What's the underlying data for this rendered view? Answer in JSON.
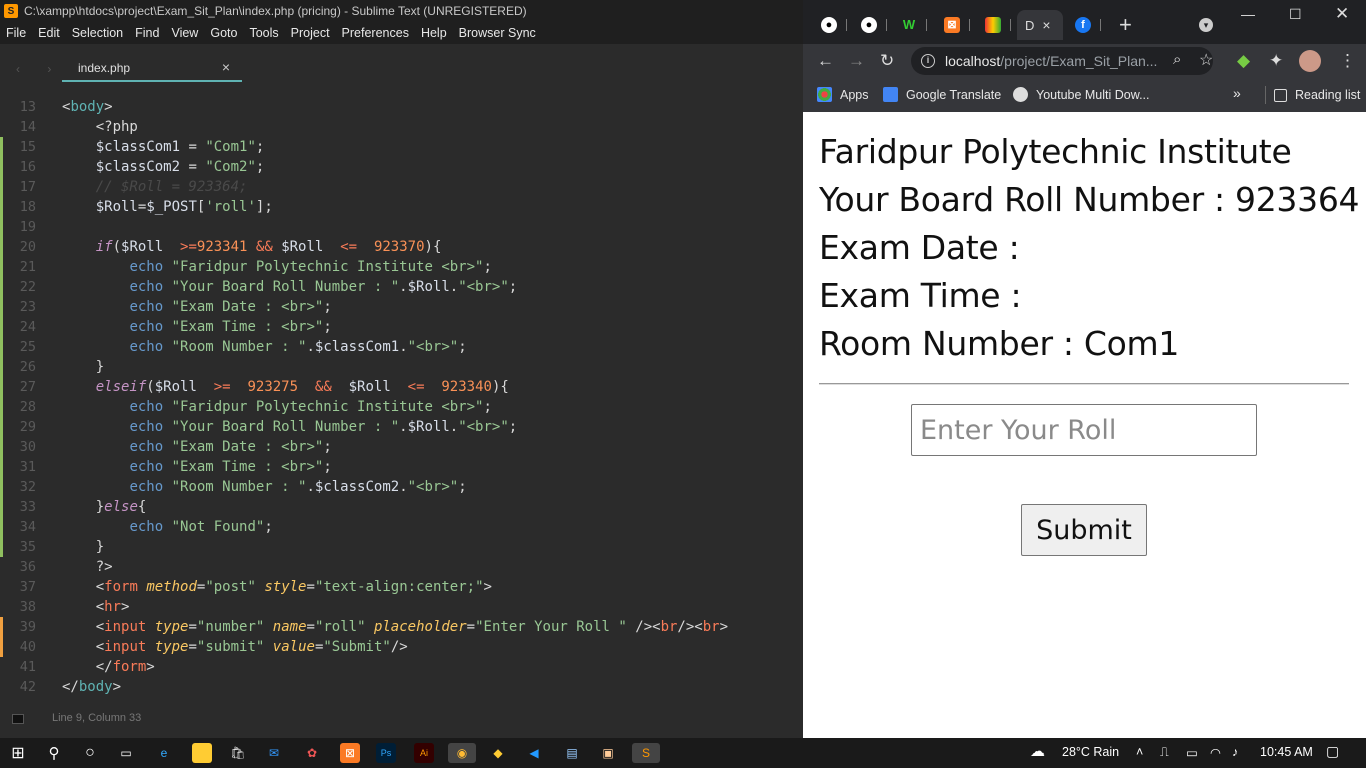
{
  "sublime": {
    "title": "C:\\xampp\\htdocs\\project\\Exam_Sit_Plan\\index.php (pricing) - Sublime Text (UNREGISTERED)",
    "menu": [
      "File",
      "Edit",
      "Selection",
      "Find",
      "View",
      "Goto",
      "Tools",
      "Project",
      "Preferences",
      "Help",
      "Browser Sync"
    ],
    "tab_label": "index.php",
    "status": "Line 9, Column 33",
    "lines": [
      {
        "n": "13",
        "mod": "",
        "html": "<span class=\"punc\">&lt;</span><span class=\"t\">body</span><span class=\"punc\">&gt;</span>"
      },
      {
        "n": "14",
        "mod": "",
        "html": "    <span class=\"punc\">&lt;?php</span>"
      },
      {
        "n": "15",
        "mod": "g",
        "html": "    <span class=\"var\">$classCom1</span> = <span class=\"str\">\"Com1\"</span>;"
      },
      {
        "n": "16",
        "mod": "g",
        "html": "    <span class=\"var\">$classCom2</span> = <span class=\"str\">\"Com2\"</span>;"
      },
      {
        "n": "17",
        "mod": "g",
        "html": "    <span class=\"cmt\">// $Roll = 923364;</span>"
      },
      {
        "n": "18",
        "mod": "g",
        "html": "    <span class=\"var\">$Roll</span>=<span class=\"var\">$_POST</span>[<span class=\"str\">'roll'</span>];"
      },
      {
        "n": "19",
        "mod": "g",
        "html": ""
      },
      {
        "n": "20",
        "mod": "g",
        "html": "    <span class=\"kw\">if</span>(<span class=\"var\">$Roll</span>  <span class=\"op\">&gt;=</span><span class=\"num\">923341</span> <span class=\"op\">&amp;&amp;</span> <span class=\"var\">$Roll</span>  <span class=\"op\">&lt;=</span>  <span class=\"num\">923370</span>){"
      },
      {
        "n": "21",
        "mod": "g",
        "html": "        <span class=\"fn\">echo</span> <span class=\"str\">\"Faridpur Polytechnic Institute &lt;br&gt;\"</span>;"
      },
      {
        "n": "22",
        "mod": "g",
        "html": "        <span class=\"fn\">echo</span> <span class=\"str\">\"Your Board Roll Number : \"</span>.<span class=\"var\">$Roll</span>.<span class=\"str\">\"&lt;br&gt;\"</span>;"
      },
      {
        "n": "23",
        "mod": "g",
        "html": "        <span class=\"fn\">echo</span> <span class=\"str\">\"Exam Date : &lt;br&gt;\"</span>;"
      },
      {
        "n": "24",
        "mod": "g",
        "html": "        <span class=\"fn\">echo</span> <span class=\"str\">\"Exam Time : &lt;br&gt;\"</span>;"
      },
      {
        "n": "25",
        "mod": "g",
        "html": "        <span class=\"fn\">echo</span> <span class=\"str\">\"Room Number : \"</span>.<span class=\"var\">$classCom1</span>.<span class=\"str\">\"&lt;br&gt;\"</span>;"
      },
      {
        "n": "26",
        "mod": "g",
        "html": "    }"
      },
      {
        "n": "27",
        "mod": "g",
        "html": "    <span class=\"kw\">elseif</span>(<span class=\"var\">$Roll</span>  <span class=\"op\">&gt;=</span>  <span class=\"num\">923275</span>  <span class=\"op\">&amp;&amp;</span>  <span class=\"var\">$Roll</span>  <span class=\"op\">&lt;=</span>  <span class=\"num\">923340</span>){"
      },
      {
        "n": "28",
        "mod": "g",
        "html": "        <span class=\"fn\">echo</span> <span class=\"str\">\"Faridpur Polytechnic Institute &lt;br&gt;\"</span>;"
      },
      {
        "n": "29",
        "mod": "g",
        "html": "        <span class=\"fn\">echo</span> <span class=\"str\">\"Your Board Roll Number : \"</span>.<span class=\"var\">$Roll</span>.<span class=\"str\">\"&lt;br&gt;\"</span>;"
      },
      {
        "n": "30",
        "mod": "g",
        "html": "        <span class=\"fn\">echo</span> <span class=\"str\">\"Exam Date : &lt;br&gt;\"</span>;"
      },
      {
        "n": "31",
        "mod": "g",
        "html": "        <span class=\"fn\">echo</span> <span class=\"str\">\"Exam Time : &lt;br&gt;\"</span>;"
      },
      {
        "n": "32",
        "mod": "g",
        "html": "        <span class=\"fn\">echo</span> <span class=\"str\">\"Room Number : \"</span>.<span class=\"var\">$classCom2</span>.<span class=\"str\">\"&lt;br&gt;\"</span>;"
      },
      {
        "n": "33",
        "mod": "g",
        "html": "    }<span class=\"kw\">else</span>{"
      },
      {
        "n": "34",
        "mod": "g",
        "html": "        <span class=\"fn\">echo</span> <span class=\"str\">\"Not Found\"</span>;"
      },
      {
        "n": "35",
        "mod": "g",
        "html": "    }"
      },
      {
        "n": "36",
        "mod": "",
        "html": "    <span class=\"punc\">?&gt;</span>"
      },
      {
        "n": "37",
        "mod": "",
        "html": "    <span class=\"punc\">&lt;</span><span class=\"op\">form</span> <span class=\"attr\">method</span>=<span class=\"str\">\"post\"</span> <span class=\"attr\">style</span>=<span class=\"str\">\"text-align:center;\"</span><span class=\"punc\">&gt;</span>"
      },
      {
        "n": "38",
        "mod": "",
        "html": "    <span class=\"punc\">&lt;</span><span class=\"op\">hr</span><span class=\"punc\">&gt;</span>"
      },
      {
        "n": "39",
        "mod": "o",
        "html": "    <span class=\"punc\">&lt;</span><span class=\"op\">input</span> <span class=\"attr\">type</span>=<span class=\"str\">\"number\"</span> <span class=\"attr\">name</span>=<span class=\"str\">\"roll\"</span> <span class=\"attr\">placeholder</span>=<span class=\"str\">\"Enter Your Roll \"</span> <span class=\"punc\">/&gt;&lt;</span><span class=\"op\">br</span><span class=\"punc\">/&gt;&lt;</span><span class=\"op\">br</span><span class=\"punc\">&gt;</span>"
      },
      {
        "n": "40",
        "mod": "o",
        "html": "    <span class=\"punc\">&lt;</span><span class=\"op\">input</span> <span class=\"attr\">type</span>=<span class=\"str\">\"submit\"</span> <span class=\"attr\">value</span>=<span class=\"str\">\"Submit\"</span><span class=\"punc\">/&gt;</span>"
      },
      {
        "n": "41",
        "mod": "",
        "html": "    <span class=\"punc\">&lt;/</span><span class=\"op\">form</span><span class=\"punc\">&gt;</span>"
      },
      {
        "n": "42",
        "mod": "",
        "html": "<span class=\"punc\">&lt;/</span><span class=\"t\">body</span><span class=\"punc\">&gt;</span>"
      }
    ]
  },
  "chrome": {
    "active_tab_label": "D",
    "url_host": "localhost",
    "url_path": "/project/Exam_Sit_Plan...",
    "bookmarks": [
      "Apps",
      "Google Translate",
      "Youtube Multi Dow..."
    ],
    "reading_list": "Reading list",
    "page": {
      "line1": "Faridpur Polytechnic Institute",
      "line2": "Your Board Roll Number : 923364",
      "line3": "Exam Date :",
      "line4": "Exam Time :",
      "line5": "Room Number : Com1",
      "input_placeholder": "Enter Your Roll ",
      "submit_label": "Submit"
    }
  },
  "taskbar": {
    "weather": "28°C  Rain",
    "time": "10:45 AM"
  }
}
